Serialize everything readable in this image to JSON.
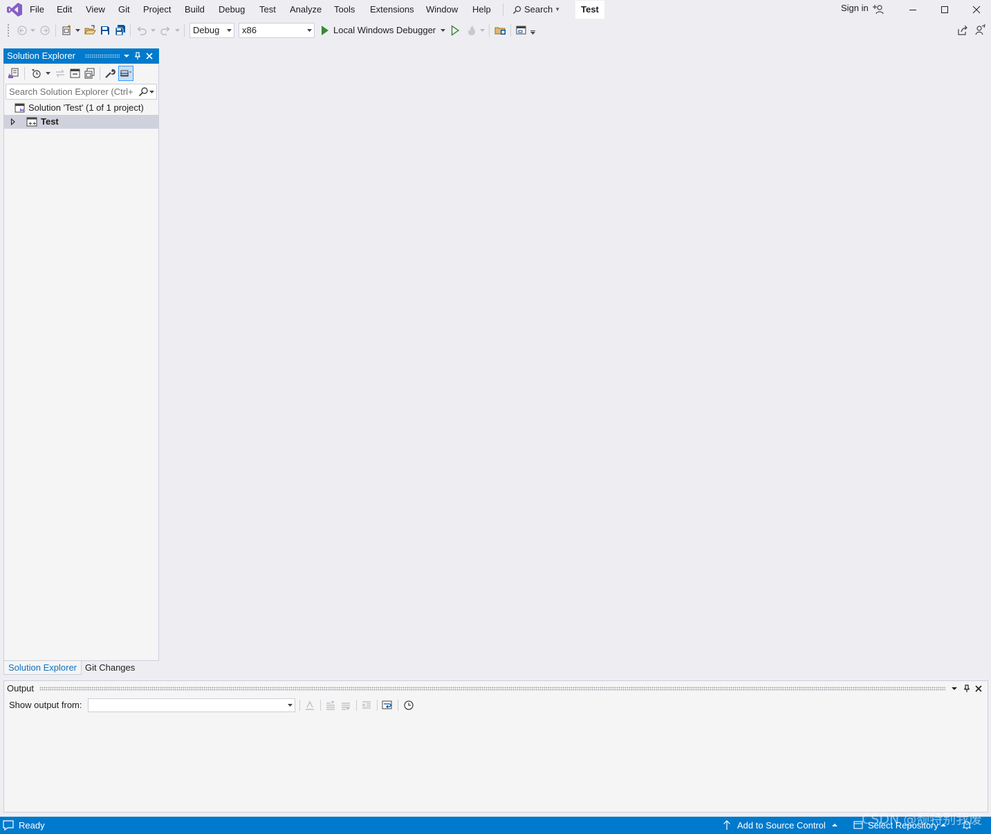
{
  "menubar": {
    "items": [
      "File",
      "Edit",
      "View",
      "Git",
      "Project",
      "Build",
      "Debug",
      "Test",
      "Analyze",
      "Tools",
      "Extensions",
      "Window",
      "Help"
    ],
    "search_label": "Search",
    "solution_name": "Test",
    "sign_in": "Sign in"
  },
  "toolbar": {
    "configuration": "Debug",
    "platform": "x86",
    "run_target": "Local Windows Debugger"
  },
  "solution_explorer": {
    "title": "Solution Explorer",
    "search_placeholder": "Search Solution Explorer (Ctrl+",
    "solution_node": "Solution 'Test' (1 of 1 project)",
    "project_node": "Test",
    "tabs": [
      "Solution Explorer",
      "Git Changes"
    ]
  },
  "output": {
    "title": "Output",
    "show_from_label": "Show output from:",
    "source": ""
  },
  "statusbar": {
    "status": "Ready",
    "source_control": "Add to Source Control",
    "repository": "Select Repository"
  },
  "watermark": "CSDN @颓特别我废",
  "colors": {
    "accent": "#007acc",
    "background": "#eeeef2",
    "panel": "#f5f5f5",
    "selected_row": "#cfd1dd",
    "vs_purple": "#865fc5"
  }
}
